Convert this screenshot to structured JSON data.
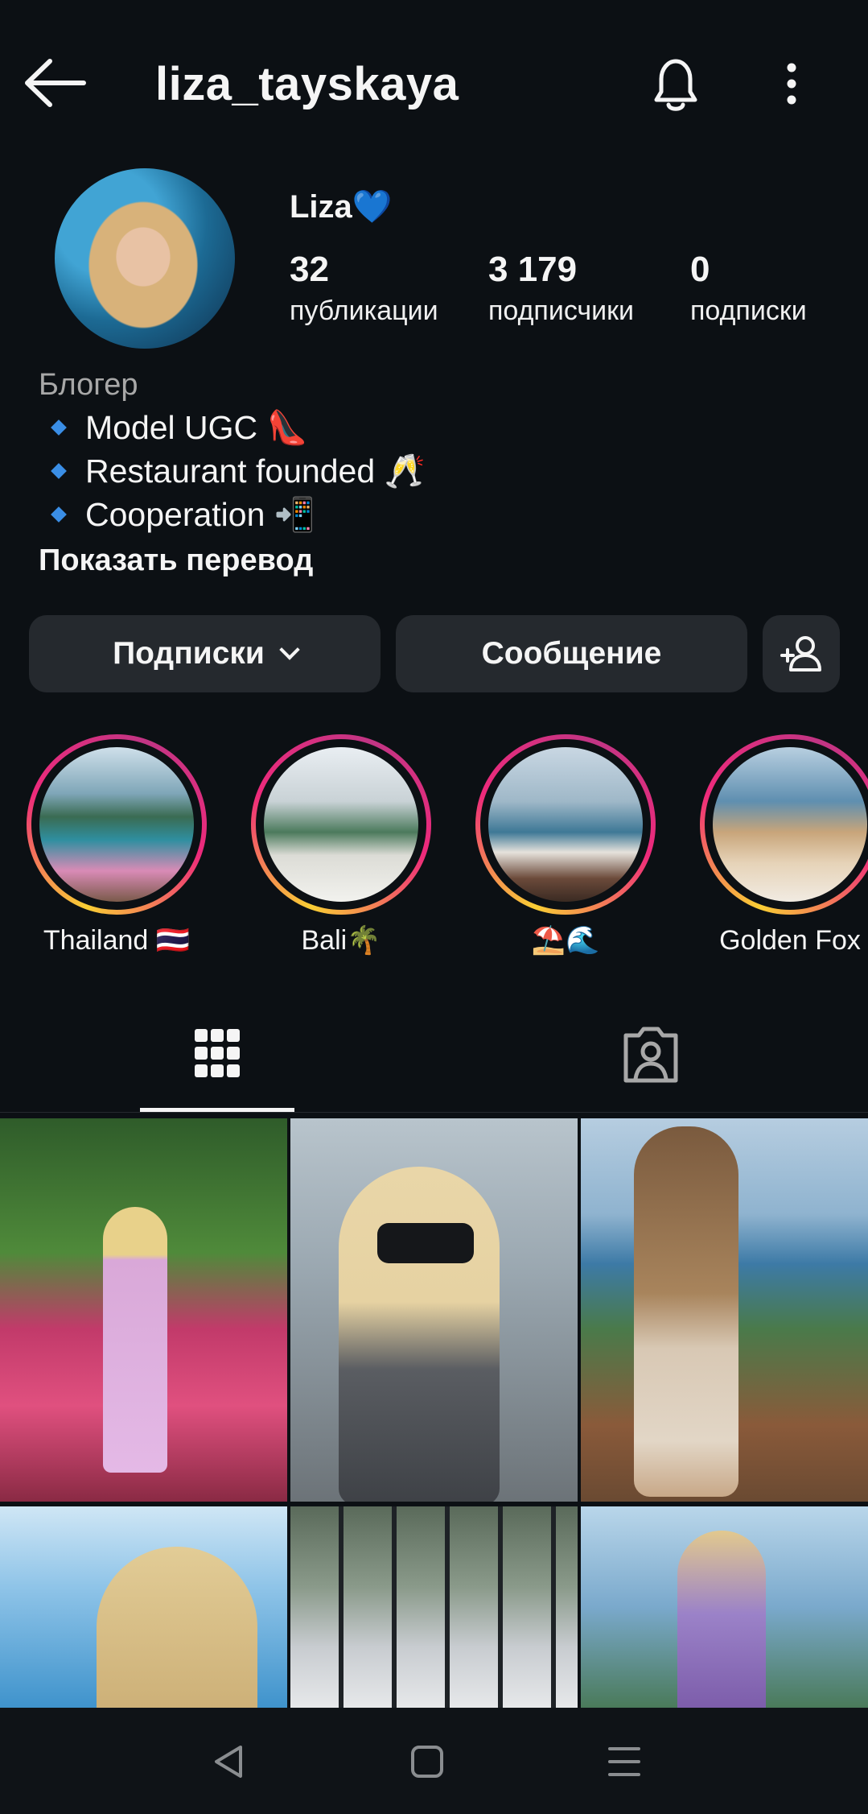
{
  "header": {
    "username": "liza_tayskaya",
    "back_icon": "arrow-left-icon",
    "bell_icon": "bell-icon",
    "more_icon": "more-vertical-icon"
  },
  "profile": {
    "display_name": "Liza💙",
    "stats": [
      {
        "value": "32",
        "label": "публикации"
      },
      {
        "value": "3 179",
        "label": "подписчики"
      },
      {
        "value": "0",
        "label": "подписки"
      }
    ],
    "bio": {
      "category": "Блогер",
      "lines": [
        "Model UGC 👠",
        "Restaurant founded 🥂",
        "Cooperation 📲"
      ],
      "translate": "Показать перевод"
    }
  },
  "actions": {
    "following_label": "Подписки",
    "message_label": "Сообщение",
    "add_user_icon": "add-user-icon"
  },
  "highlights": [
    {
      "label": "Thailand 🇹🇭"
    },
    {
      "label": "Bali🌴"
    },
    {
      "label": "⛱️🌊"
    },
    {
      "label": "Golden Fox"
    }
  ],
  "tabs": [
    {
      "name": "posts-grid",
      "icon": "grid-icon",
      "active": true
    },
    {
      "name": "tagged",
      "icon": "tagged-person-icon",
      "active": false
    }
  ],
  "colors": {
    "background": "#0c1014",
    "button": "#25292e",
    "text": "#f5f5f5",
    "secondary_text": "#a8a8a8",
    "ring_start": "#f9ce34",
    "ring_end": "#c13584"
  },
  "navbar": {
    "back_icon": "triangle-back-icon",
    "home_icon": "square-home-icon",
    "menu_icon": "menu-lines-icon"
  }
}
